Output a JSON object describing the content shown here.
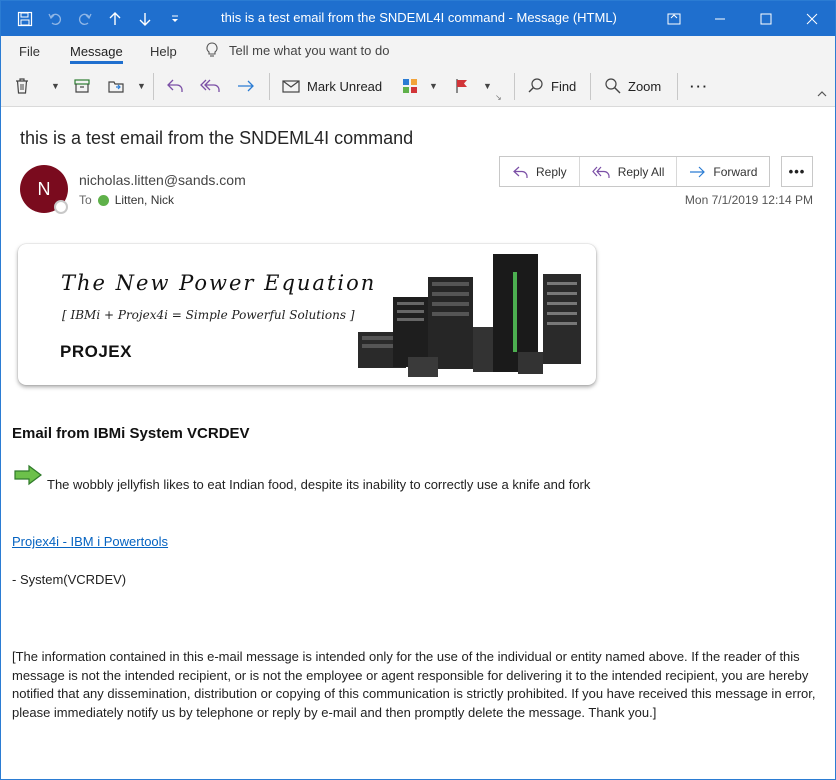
{
  "window": {
    "title": "this is a test email from the SNDEML4I command  -  Message (HTML)"
  },
  "menu": {
    "tabs": [
      "File",
      "Message",
      "Help"
    ],
    "tell_me": "Tell me what you want to do"
  },
  "ribbon": {
    "mark_unread": "Mark Unread",
    "find": "Find",
    "zoom": "Zoom",
    "more": "···"
  },
  "message": {
    "subject": "this is a test email from the SNDEML4I command",
    "avatar_initial": "N",
    "sender": "nicholas.litten@sands.com",
    "to_label": "To",
    "recipient": "Litten, Nick",
    "date": "Mon 7/1/2019 12:14 PM",
    "actions": [
      "Reply",
      "Reply All",
      "Forward"
    ],
    "more": "•••"
  },
  "banner": {
    "title": "The New Power Equation",
    "subtitle": "[ IBMi + Projex4i = Simple Powerful Solutions ]",
    "logo": "PROJEX"
  },
  "body": {
    "heading": "Email from IBMi System VCRDEV",
    "line": "The wobbly jellyfish likes to eat Indian food, despite its inability to correctly use a knife and fork",
    "link": "Projex4i - IBM i Powertools",
    "system": "- System(VCRDEV)",
    "disclaimer": "[The information contained in this e-mail message is intended only for the use of the individual or entity named above. If the reader of this message is not the intended recipient, or is not the employee or agent responsible for delivering it to the intended recipient, you are hereby notified that any dissemination, distribution or copying of this communication is strictly prohibited. If you have received this message in error, please immediately notify us by telephone or reply by e-mail and then promptly delete the message. Thank you.]"
  },
  "colors": {
    "titlebar": "#1f6fce",
    "avatar": "#7a0b1e",
    "link": "#0563c1",
    "reply_icon": "#7b4fa6",
    "forward_icon": "#2b7cd3",
    "flag": "#d13438"
  }
}
